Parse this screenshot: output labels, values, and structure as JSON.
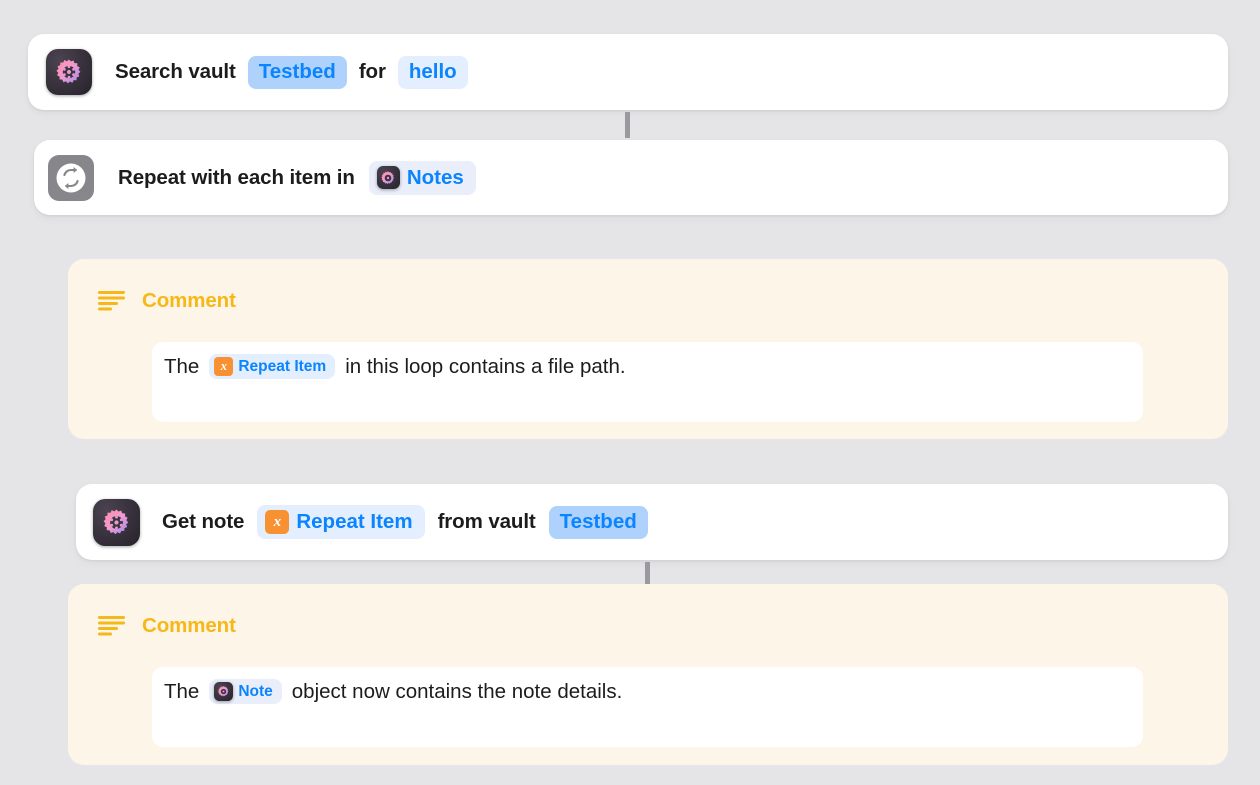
{
  "theme": {
    "background": "#e5e5e7",
    "card_background": "#ffffff",
    "comment_background": "#fdf5e7",
    "comment_accent": "#f5b818",
    "token_blue": "#0a84ff",
    "token_blue_strong_bg": "#aed2fb",
    "token_blue_soft_bg": "#e3eefe",
    "token_lavender_bg": "#eaeefb",
    "variable_chip_orange": "#f79131",
    "repeat_icon_gray": "#86868b",
    "connector_gray": "#9a9a9e"
  },
  "actions": [
    {
      "id": "search-vault",
      "icon": "obsidian-gear-app-icon",
      "segments": [
        {
          "kind": "text",
          "value": "Search vault"
        },
        {
          "kind": "token",
          "value": "Testbed",
          "style": "strong"
        },
        {
          "kind": "text",
          "value": "for"
        },
        {
          "kind": "token",
          "value": "hello",
          "style": "soft"
        }
      ]
    },
    {
      "id": "repeat-with-each-item",
      "icon": "repeat-loop-icon",
      "segments": [
        {
          "kind": "text",
          "value": "Repeat with each item in"
        },
        {
          "kind": "app-token",
          "value": "Notes",
          "style": "lav",
          "chip": "obsidian-gear-app-icon"
        }
      ]
    },
    {
      "id": "get-note",
      "icon": "obsidian-gear-app-icon",
      "segments": [
        {
          "kind": "text",
          "value": "Get note"
        },
        {
          "kind": "var-token",
          "value": "Repeat Item",
          "style": "soft",
          "chip": "x"
        },
        {
          "kind": "text",
          "value": "from vault"
        },
        {
          "kind": "token",
          "value": "Testbed",
          "style": "strong"
        }
      ]
    }
  ],
  "comments": [
    {
      "id": "comment-repeat-item",
      "icon": "text-lines-icon",
      "title": "Comment",
      "body_segments": [
        {
          "kind": "text",
          "value": "The"
        },
        {
          "kind": "var-token",
          "value": "Repeat Item",
          "style": "soft",
          "chip": "x"
        },
        {
          "kind": "text",
          "value": "in this loop contains a file path."
        }
      ]
    },
    {
      "id": "comment-note-object",
      "icon": "text-lines-icon",
      "title": "Comment",
      "body_segments": [
        {
          "kind": "text",
          "value": "The"
        },
        {
          "kind": "app-token",
          "value": "Note",
          "style": "lav",
          "chip": "obsidian-gear-app-icon"
        },
        {
          "kind": "text",
          "value": "object now contains the note details."
        }
      ]
    }
  ],
  "labels": {
    "action_1_text_1": "Search vault",
    "action_1_token_1": "Testbed",
    "action_1_text_2": "for",
    "action_1_token_2": "hello",
    "action_2_text_1": "Repeat with each item in",
    "action_2_token_1": "Notes",
    "action_3_text_1": "Get note",
    "action_3_token_1": "Repeat Item",
    "action_3_text_2": "from vault",
    "action_3_token_2": "Testbed",
    "comment_1_title": "Comment",
    "comment_1_text_1": "The",
    "comment_1_token_1": "Repeat Item",
    "comment_1_text_2": "in this loop contains a file path.",
    "comment_2_title": "Comment",
    "comment_2_text_1": "The",
    "comment_2_token_1": "Note",
    "comment_2_text_2": "object now contains the note details.",
    "variable_glyph": "x"
  }
}
